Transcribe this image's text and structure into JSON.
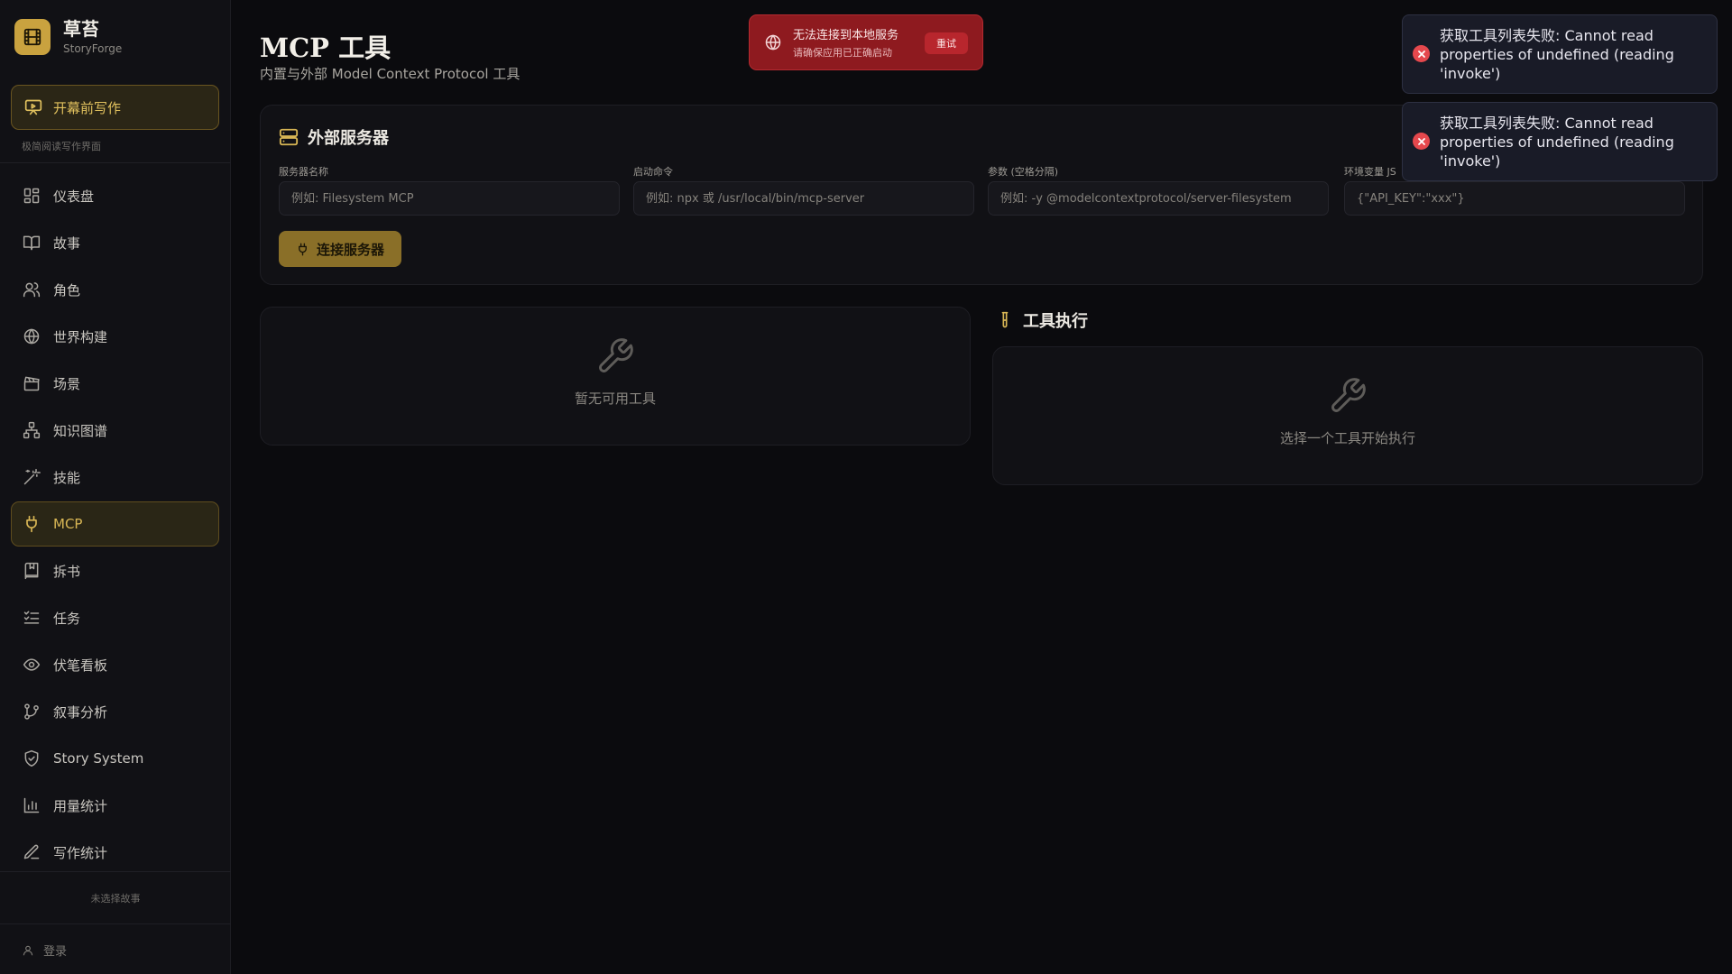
{
  "brand": {
    "name": "草苔",
    "subtitle": "StoryForge"
  },
  "sidebar": {
    "primary_action": "开幕前写作",
    "primary_hint": "极简阅读写作界面",
    "items": [
      {
        "label": "仪表盘",
        "icon": "dashboard-icon"
      },
      {
        "label": "故事",
        "icon": "book-icon"
      },
      {
        "label": "角色",
        "icon": "users-icon"
      },
      {
        "label": "世界构建",
        "icon": "globe-icon"
      },
      {
        "label": "场景",
        "icon": "clapperboard-icon"
      },
      {
        "label": "知识图谱",
        "icon": "network-icon"
      },
      {
        "label": "技能",
        "icon": "wand-icon"
      },
      {
        "label": "MCP",
        "icon": "plug-icon",
        "active": true
      },
      {
        "label": "拆书",
        "icon": "bookmark-book-icon"
      },
      {
        "label": "任务",
        "icon": "checklist-icon"
      },
      {
        "label": "伏笔看板",
        "icon": "eye-icon"
      },
      {
        "label": "叙事分析",
        "icon": "git-branch-icon"
      },
      {
        "label": "Story System",
        "icon": "shield-icon"
      },
      {
        "label": "用量统计",
        "icon": "bar-chart-icon"
      },
      {
        "label": "写作统计",
        "icon": "pen-icon"
      }
    ],
    "footer_note": "未选择故事",
    "login": "登录"
  },
  "page": {
    "title": "MCP 工具",
    "subtitle": "内置与外部 Model Context Protocol 工具"
  },
  "server_form": {
    "title": "外部服务器",
    "fields": [
      {
        "label": "服务器名称",
        "placeholder": "例如: Filesystem MCP",
        "value": ""
      },
      {
        "label": "启动命令",
        "placeholder": "例如: npx 或 /usr/local/bin/mcp-server",
        "value": ""
      },
      {
        "label": "参数 (空格分隔)",
        "placeholder": "例如: -y @modelcontextprotocol/server-filesystem",
        "value": ""
      },
      {
        "label": "环境变量 JS",
        "placeholder": "{\"API_KEY\":\"xxx\"}",
        "value": ""
      }
    ],
    "connect_label": "连接服务器"
  },
  "tools": {
    "empty_text": "暂无可用工具"
  },
  "execution": {
    "title": "工具执行",
    "empty_text": "选择一个工具开始执行"
  },
  "banner": {
    "title": "无法连接到本地服务",
    "subtitle": "请确保应用已正确启动",
    "retry_label": "重试"
  },
  "toasts": [
    {
      "message": "获取工具列表失败: Cannot read properties of undefined (reading 'invoke')"
    },
    {
      "message": "获取工具列表失败: Cannot read properties of undefined (reading 'invoke')"
    }
  ],
  "colors": {
    "accent": "#c9a23f",
    "background": "#0b0b0e",
    "error": "#e5484d",
    "banner": "#8e1a1f"
  }
}
